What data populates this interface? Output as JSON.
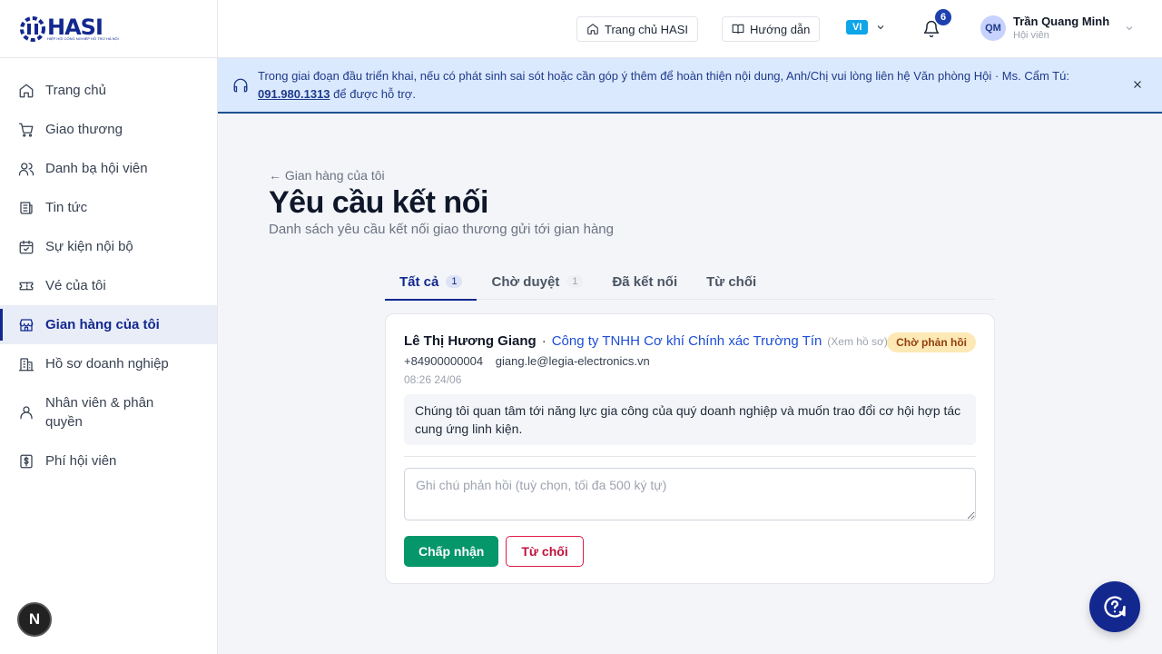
{
  "brand": {
    "name": "HASI",
    "tagline": "HIỆP HỘI CÔNG NGHIỆP HỖ TRỢ HÀ NỘI",
    "color": "#13288f"
  },
  "sidebar": {
    "items": [
      {
        "label": "Trang chủ",
        "icon": "home-icon"
      },
      {
        "label": "Giao thương",
        "icon": "cart-icon"
      },
      {
        "label": "Danh bạ hội viên",
        "icon": "users-icon"
      },
      {
        "label": "Tin tức",
        "icon": "newspaper-icon"
      },
      {
        "label": "Sự kiện nội bộ",
        "icon": "calendar-check-icon"
      },
      {
        "label": "Vé của tôi",
        "icon": "ticket-icon"
      },
      {
        "label": "Gian hàng của tôi",
        "icon": "store-icon",
        "active": true
      },
      {
        "label": "Hồ sơ doanh nghiệp",
        "icon": "building-icon"
      },
      {
        "label": "Nhân viên & phân quyền",
        "icon": "user-icon"
      },
      {
        "label": "Phí hội viên",
        "icon": "dollar-icon"
      }
    ],
    "corner_badge": "N"
  },
  "header": {
    "home_label": "Trang chủ HASI",
    "guide_label": "Hướng dẫn",
    "lang": "VI",
    "notification_count": "6",
    "user": {
      "initials": "QM",
      "name": "Trần Quang Minh",
      "role": "Hội viên"
    }
  },
  "notice": {
    "text": "Trong giai đoạn đầu triển khai, nếu có phát sinh sai sót hoặc cần góp ý thêm để hoàn thiện nội dung, Anh/Chị vui lòng liên hệ Văn phòng Hội · Ms. Cẩm Tú: ",
    "phone": "091.980.1313",
    "suffix": " để được hỗ trợ."
  },
  "page": {
    "back": "← Gian hàng của tôi",
    "title": "Yêu cầu kết nối",
    "subtitle": "Danh sách yêu cầu kết nối giao thương gửi tới gian hàng"
  },
  "tabs": [
    {
      "label": "Tất cả",
      "count": "1",
      "active": true
    },
    {
      "label": "Chờ duyệt",
      "count": "1"
    },
    {
      "label": "Đã kết nối"
    },
    {
      "label": "Từ chối"
    }
  ],
  "request": {
    "name": "Lê Thị Hương Giang",
    "separator": "·",
    "company": "Công ty TNHH Cơ khí Chính xác Trường Tín",
    "view_profile": "(Xem hồ sơ)",
    "status": "Chờ phản hồi",
    "phone": "+84900000004",
    "email": "giang.le@legia-electronics.vn",
    "time": "08:26 24/06",
    "message": "Chúng tôi quan tâm tới năng lực gia công của quý doanh nghiệp và muốn trao đổi cơ hội hợp tác cung ứng linh kiện.",
    "note_placeholder": "Ghi chú phản hồi (tuỳ chọn, tối đa 500 ký tự)",
    "accept_label": "Chấp nhận",
    "reject_label": "Từ chối"
  }
}
